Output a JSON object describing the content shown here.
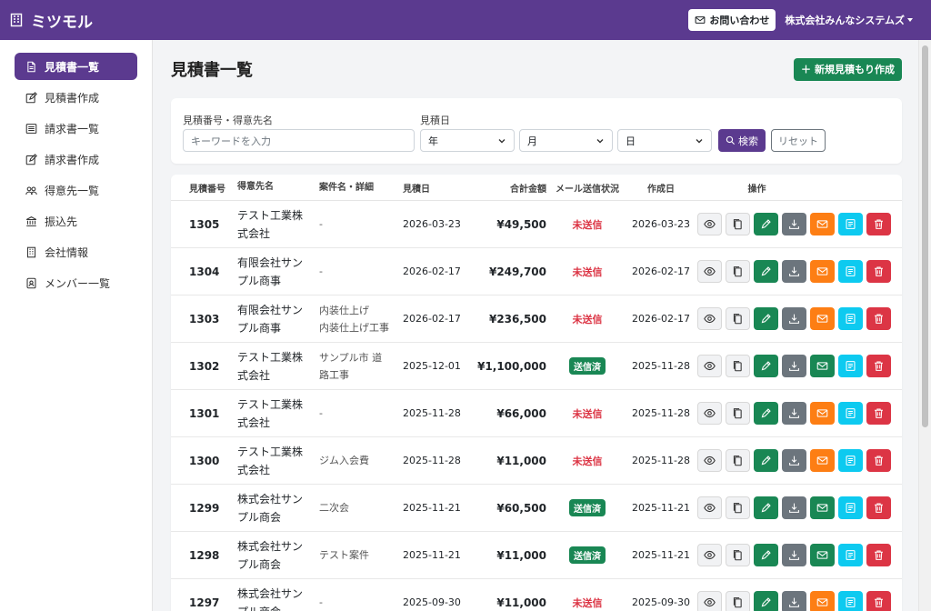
{
  "app": {
    "name": "ミツモル",
    "contact_label": "お問い合わせ",
    "company_name": "株式会社みんなシステムズ"
  },
  "sidebar": {
    "items": [
      {
        "label": "見積書一覧",
        "icon": "document-icon",
        "active": true
      },
      {
        "label": "見積書作成",
        "icon": "edit-icon"
      },
      {
        "label": "請求書一覧",
        "icon": "list-icon"
      },
      {
        "label": "請求書作成",
        "icon": "edit-icon"
      },
      {
        "label": "得意先一覧",
        "icon": "people-icon"
      },
      {
        "label": "振込先",
        "icon": "bank-icon"
      },
      {
        "label": "会社情報",
        "icon": "building-icon"
      },
      {
        "label": "メンバー一覧",
        "icon": "person-badge-icon"
      }
    ]
  },
  "main": {
    "title": "見積書一覧",
    "new_button": "新規見積もり作成",
    "filter": {
      "keyword_label": "見積番号・得意先名",
      "keyword_placeholder": "キーワードを入力",
      "date_label": "見積日",
      "year": "年",
      "month": "月",
      "day": "日",
      "search": "検索",
      "reset": "リセット"
    },
    "table": {
      "headers": {
        "no": "見積番号",
        "customer": "得意先名",
        "case": "案件名・詳細",
        "date": "見積日",
        "amount": "合計金額",
        "mail": "メール送信状況",
        "created": "作成日",
        "ops": "操作"
      },
      "rows": [
        {
          "no": "1305",
          "customer": [
            "テスト工業株",
            "式会社"
          ],
          "case": [
            "-"
          ],
          "date": "2026-03-23",
          "amount": "¥49,500",
          "mail": "未送信",
          "sent": false,
          "created": "2026-03-23"
        },
        {
          "no": "1304",
          "customer": [
            "有限会社サン",
            "プル商事"
          ],
          "case": [
            "-"
          ],
          "date": "2026-02-17",
          "amount": "¥249,700",
          "mail": "未送信",
          "sent": false,
          "created": "2026-02-17"
        },
        {
          "no": "1303",
          "customer": [
            "有限会社サン",
            "プル商事"
          ],
          "case": [
            "内装仕上げ",
            "内装仕上げ工事"
          ],
          "date": "2026-02-17",
          "amount": "¥236,500",
          "mail": "未送信",
          "sent": false,
          "created": "2026-02-17"
        },
        {
          "no": "1302",
          "customer": [
            "テスト工業株",
            "式会社"
          ],
          "case": [
            "サンプル市 道",
            "路工事"
          ],
          "date": "2025-12-01",
          "amount": "¥1,100,000",
          "mail": "送信済",
          "sent": true,
          "created": "2025-11-28"
        },
        {
          "no": "1301",
          "customer": [
            "テスト工業株",
            "式会社"
          ],
          "case": [
            "-"
          ],
          "date": "2025-11-28",
          "amount": "¥66,000",
          "mail": "未送信",
          "sent": false,
          "created": "2025-11-28"
        },
        {
          "no": "1300",
          "customer": [
            "テスト工業株",
            "式会社"
          ],
          "case": [
            "ジム入会費"
          ],
          "date": "2025-11-28",
          "amount": "¥11,000",
          "mail": "未送信",
          "sent": false,
          "created": "2025-11-28"
        },
        {
          "no": "1299",
          "customer": [
            "株式会社サン",
            "プル商会"
          ],
          "case": [
            "二次会"
          ],
          "date": "2025-11-21",
          "amount": "¥60,500",
          "mail": "送信済",
          "sent": true,
          "created": "2025-11-21"
        },
        {
          "no": "1298",
          "customer": [
            "株式会社サン",
            "プル商会"
          ],
          "case": [
            "テスト案件"
          ],
          "date": "2025-11-21",
          "amount": "¥11,000",
          "mail": "送信済",
          "sent": true,
          "created": "2025-11-21"
        },
        {
          "no": "1297",
          "customer": [
            "株式会社サン",
            "プル商会"
          ],
          "case": [
            "-"
          ],
          "date": "2025-09-30",
          "amount": "¥11,000",
          "mail": "未送信",
          "sent": false,
          "created": "2025-09-30"
        }
      ]
    }
  }
}
